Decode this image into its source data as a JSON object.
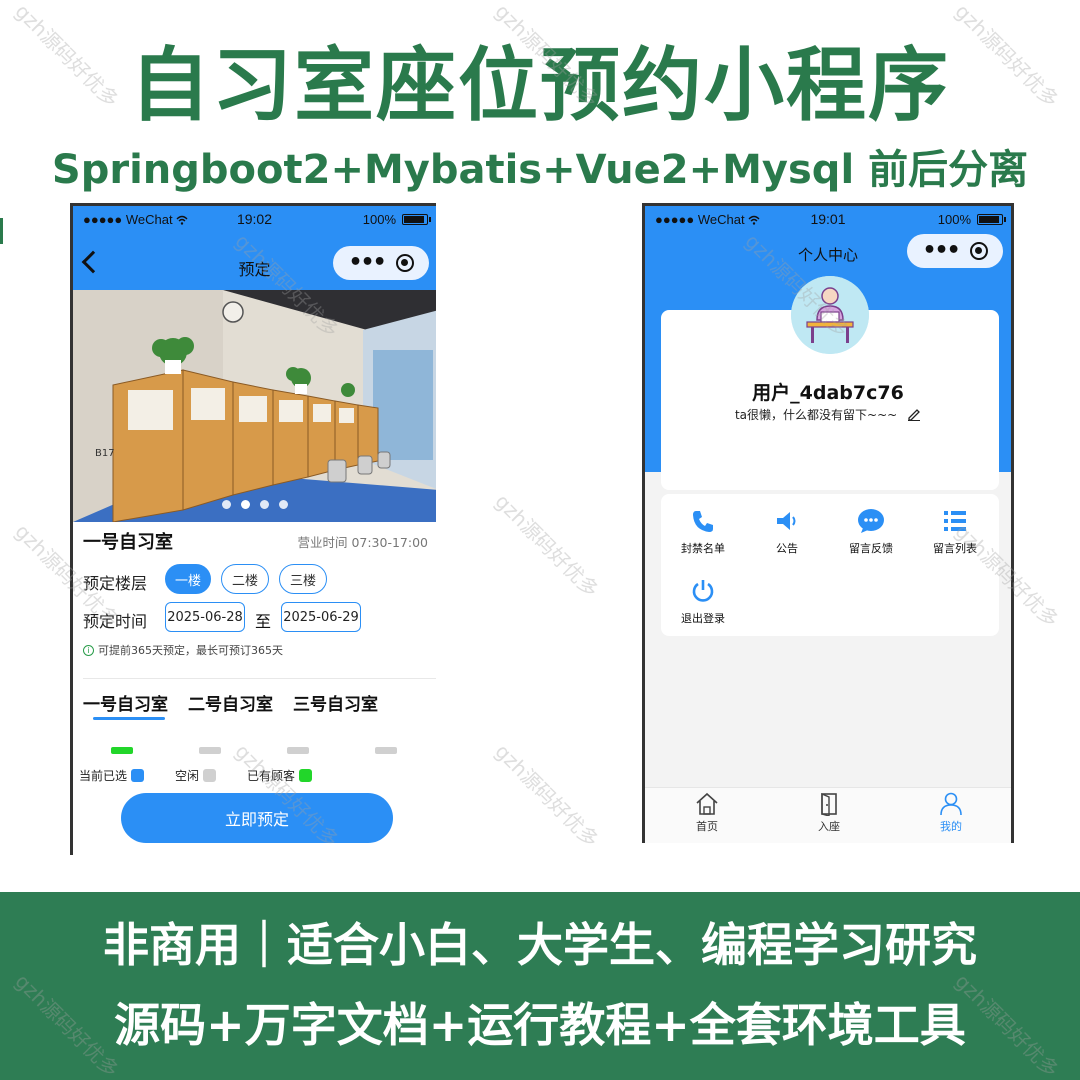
{
  "poster": {
    "title": "自习室座位预约小程序",
    "subtitle": "Springboot2+Mybatis+Vue2+Mysql 前后分离",
    "banner_line1": "非商用｜适合小白、大学生、编程学习研究",
    "banner_line2": "源码+万字文档+运行教程+全套环境工具",
    "watermark": "gzh源码好优多",
    "colors": {
      "brand_green": "#2a7a4c",
      "banner_green": "#2e7d54",
      "primary_blue": "#2b8ff5",
      "seat_occupied": "#22d62a",
      "seat_free": "#d0d0d0"
    }
  },
  "left_phone": {
    "status": {
      "carrier": "●●●●● WeChat",
      "time": "19:02",
      "battery": "100%"
    },
    "nav": {
      "title": "预定",
      "back_icon": "chevron-left-icon",
      "more_icon": "more-dots-icon",
      "close_icon": "target-icon"
    },
    "carousel": {
      "slides": 4,
      "active_index": 1
    },
    "room": {
      "name": "一号自习室",
      "hours": "营业时间 07:30-17:00"
    },
    "floor": {
      "label": "预定楼层",
      "options": [
        "一楼",
        "二楼",
        "三楼"
      ],
      "selected": "一楼"
    },
    "time": {
      "label": "预定时间",
      "start": "2025-06-28",
      "to": "至",
      "end": "2025-06-29"
    },
    "hint": "可提前365天预定，最长可预订365天",
    "room_tabs": [
      "一号自习室",
      "二号自习室",
      "三号自习室"
    ],
    "active_room_tab": "一号自习室",
    "seats": [
      "occupied",
      "free",
      "free",
      "free"
    ],
    "legend": [
      "当前已选",
      "空闲",
      "已有顾客"
    ],
    "reserve_button": "立即预定"
  },
  "right_phone": {
    "status": {
      "carrier": "●●●●● WeChat",
      "time": "19:01",
      "battery": "100%"
    },
    "nav": {
      "title": "个人中心"
    },
    "profile": {
      "username": "用户_4dab7c76",
      "bio": "ta很懒，什么都没有留下~~~"
    },
    "menu": [
      {
        "label": "封禁名单",
        "icon": "phone-icon"
      },
      {
        "label": "公告",
        "icon": "megaphone-icon"
      },
      {
        "label": "留言反馈",
        "icon": "chat-bubble-icon"
      },
      {
        "label": "留言列表",
        "icon": "list-icon"
      },
      {
        "label": "退出登录",
        "icon": "power-icon"
      }
    ],
    "tabbar": [
      {
        "label": "首页",
        "icon": "home-icon"
      },
      {
        "label": "入座",
        "icon": "door-icon"
      },
      {
        "label": "我的",
        "icon": "user-icon",
        "active": true
      }
    ]
  }
}
